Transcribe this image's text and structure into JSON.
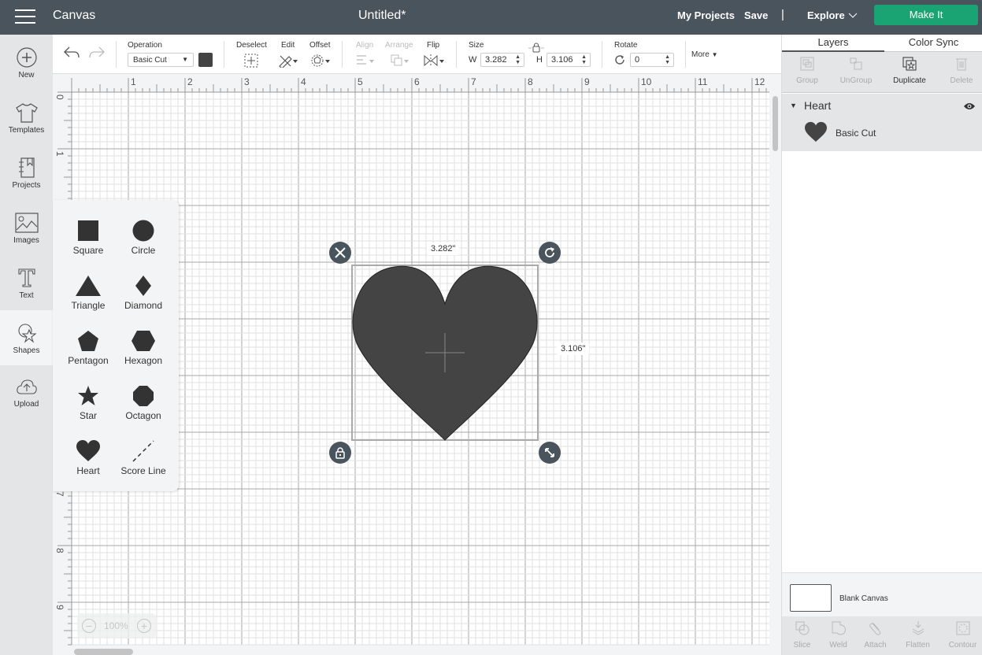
{
  "header": {
    "app_name": "Canvas",
    "document_title": "Untitled*",
    "nav": {
      "my_projects": "My Projects",
      "save": "Save",
      "separator": "|",
      "explore": "Explore"
    },
    "make_it": "Make It",
    "make_it_color": "#1aa473"
  },
  "sidebar": {
    "items": [
      {
        "label": "New",
        "icon": "plus-circle-icon"
      },
      {
        "label": "Templates",
        "icon": "tshirt-icon"
      },
      {
        "label": "Projects",
        "icon": "notebook-icon"
      },
      {
        "label": "Images",
        "icon": "image-icon"
      },
      {
        "label": "Text",
        "icon": "text-t-icon"
      },
      {
        "label": "Shapes",
        "icon": "shapes-icon",
        "active": true
      },
      {
        "label": "Upload",
        "icon": "cloud-upload-icon"
      }
    ]
  },
  "toolbar": {
    "operation_label": "Operation",
    "operation_value": "Basic Cut",
    "operation_color": "#444444",
    "deselect": "Deselect",
    "edit": "Edit",
    "offset": "Offset",
    "align": "Align",
    "arrange": "Arrange",
    "flip": "Flip",
    "size_label": "Size",
    "w_label": "W",
    "w_value": "3.282",
    "h_label": "H",
    "h_value": "3.106",
    "rotate_label": "Rotate",
    "rotate_value": "0",
    "more": "More"
  },
  "rulers": {
    "horizontal": [
      "1",
      "2",
      "3",
      "4",
      "5",
      "6",
      "7",
      "8",
      "9",
      "10",
      "11",
      "12"
    ],
    "vertical": [
      "0",
      "1",
      "7",
      "8",
      "9"
    ]
  },
  "shapes_panel": {
    "items": [
      {
        "label": "Square"
      },
      {
        "label": "Circle"
      },
      {
        "label": "Triangle"
      },
      {
        "label": "Diamond"
      },
      {
        "label": "Pentagon"
      },
      {
        "label": "Hexagon"
      },
      {
        "label": "Star"
      },
      {
        "label": "Octagon"
      },
      {
        "label": "Heart"
      },
      {
        "label": "Score Line"
      }
    ]
  },
  "selection": {
    "width_label": "3.282\"",
    "height_label": "3.106\"",
    "shape_color": "#444444"
  },
  "zoom": {
    "value": "100%",
    "minus": "−",
    "plus": "+"
  },
  "layers_panel": {
    "tabs": [
      "Layers",
      "Color Sync"
    ],
    "actions": [
      "Group",
      "UnGroup",
      "Duplicate",
      "Delete"
    ],
    "group_name": "Heart",
    "layer_name": "Basic Cut",
    "blank_canvas": "Blank Canvas",
    "bottom_actions": [
      "Slice",
      "Weld",
      "Attach",
      "Flatten",
      "Contour"
    ]
  }
}
